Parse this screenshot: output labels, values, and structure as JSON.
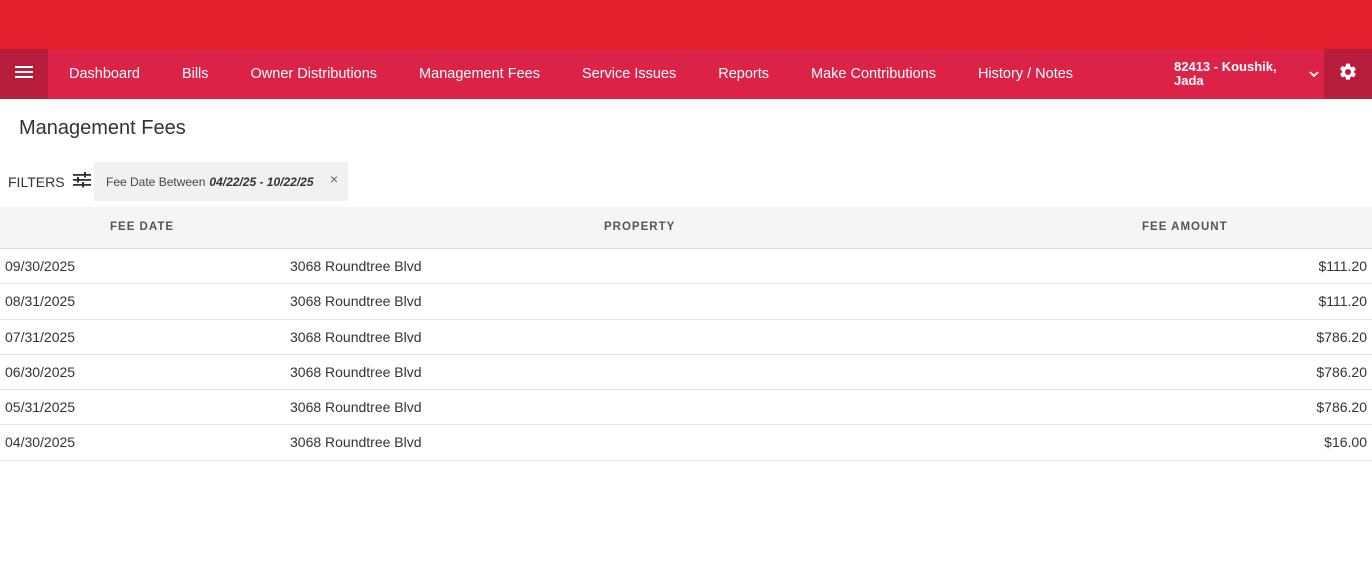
{
  "nav": {
    "items": [
      {
        "label": "Dashboard"
      },
      {
        "label": "Bills"
      },
      {
        "label": "Owner Distributions"
      },
      {
        "label": "Management Fees"
      },
      {
        "label": "Service Issues"
      },
      {
        "label": "Reports"
      },
      {
        "label": "Make Contributions"
      },
      {
        "label": "History / Notes"
      }
    ],
    "account_name": "82413 - Koushik, Jada",
    "menu_icon": "hamburger-icon",
    "settings_icon": "gear-icon",
    "colors": {
      "banner": "#e31e2d",
      "navbar": "#dc2347",
      "nav_accent": "#b81d3b"
    }
  },
  "page": {
    "title": "Management Fees"
  },
  "filters": {
    "label": "FILTERS",
    "icon": "sliders-icon",
    "chips": [
      {
        "label": "Fee Date Between",
        "value": "04/22/25 - 10/22/25",
        "close": "×"
      }
    ]
  },
  "table": {
    "headers": {
      "date": "FEE DATE",
      "property": "PROPERTY",
      "amount": "FEE AMOUNT"
    },
    "rows": [
      {
        "date": "09/30/2025",
        "property": "3068 Roundtree Blvd",
        "amount": "$111.20"
      },
      {
        "date": "08/31/2025",
        "property": "3068 Roundtree Blvd",
        "amount": "$111.20"
      },
      {
        "date": "07/31/2025",
        "property": "3068 Roundtree Blvd",
        "amount": "$786.20"
      },
      {
        "date": "06/30/2025",
        "property": "3068 Roundtree Blvd",
        "amount": "$786.20"
      },
      {
        "date": "05/31/2025",
        "property": "3068 Roundtree Blvd",
        "amount": "$786.20"
      },
      {
        "date": "04/30/2025",
        "property": "3068 Roundtree Blvd",
        "amount": "$16.00"
      }
    ]
  }
}
